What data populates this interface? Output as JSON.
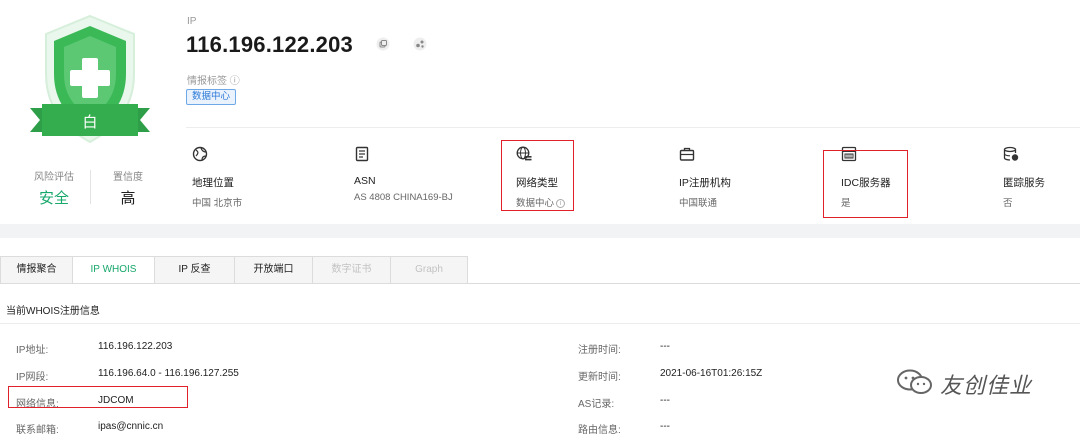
{
  "colors": {
    "safe_green": "#17a86b",
    "shield_green": "#3cb957",
    "tag_blue": "#2d7ad6",
    "highlight_red": "#e0202a"
  },
  "badge": {
    "char": "白",
    "icon": "shield-plus-icon"
  },
  "risk": {
    "label": "风险评估",
    "value": "安全",
    "confidence_label": "置信度",
    "confidence_value": "高"
  },
  "ip_header": {
    "caption": "IP",
    "address": "116.196.122.203",
    "tag_caption": "情报标签 ⓘ",
    "tag": "数据中心"
  },
  "info_cards": [
    {
      "icon": "globe-icon",
      "title": "地理位置",
      "value": "中国 北京市"
    },
    {
      "icon": "document-icon",
      "title": "ASN",
      "value": "AS 4808 CHINA169-BJ"
    },
    {
      "icon": "network-globe-icon",
      "title": "网络类型",
      "value": "数据中心"
    },
    {
      "icon": "briefcase-icon",
      "title": "IP注册机构",
      "value": "中国联通"
    },
    {
      "icon": "server-icon",
      "title": "IDC服务器",
      "value": "是"
    },
    {
      "icon": "database-icon",
      "title": "匿踪服务",
      "value": "否"
    }
  ],
  "tabs": [
    {
      "label": "情报聚合",
      "state": "normal"
    },
    {
      "label": "IP WHOIS",
      "state": "active"
    },
    {
      "label": "IP 反查",
      "state": "normal"
    },
    {
      "label": "开放端口",
      "state": "normal"
    },
    {
      "label": "数字证书",
      "state": "disabled"
    },
    {
      "label": "Graph",
      "state": "disabled"
    }
  ],
  "whois": {
    "title": "当前WHOIS注册信息",
    "left": [
      {
        "key": "IP地址:",
        "value": "116.196.122.203"
      },
      {
        "key": "IP网段:",
        "value": "116.196.64.0 - 116.196.127.255"
      },
      {
        "key": "网络信息:",
        "value": "JDCOM"
      },
      {
        "key": "联系邮箱:",
        "value": "ipas@cnnic.cn"
      }
    ],
    "right": [
      {
        "key": "注册时间:",
        "value": "---"
      },
      {
        "key": "更新时间:",
        "value": "2021-06-16T01:26:15Z"
      },
      {
        "key": "AS记录:",
        "value": "---"
      },
      {
        "key": "路由信息:",
        "value": "---"
      }
    ]
  },
  "watermark": {
    "text": "友创佳业",
    "icon": "wechat-icon"
  }
}
